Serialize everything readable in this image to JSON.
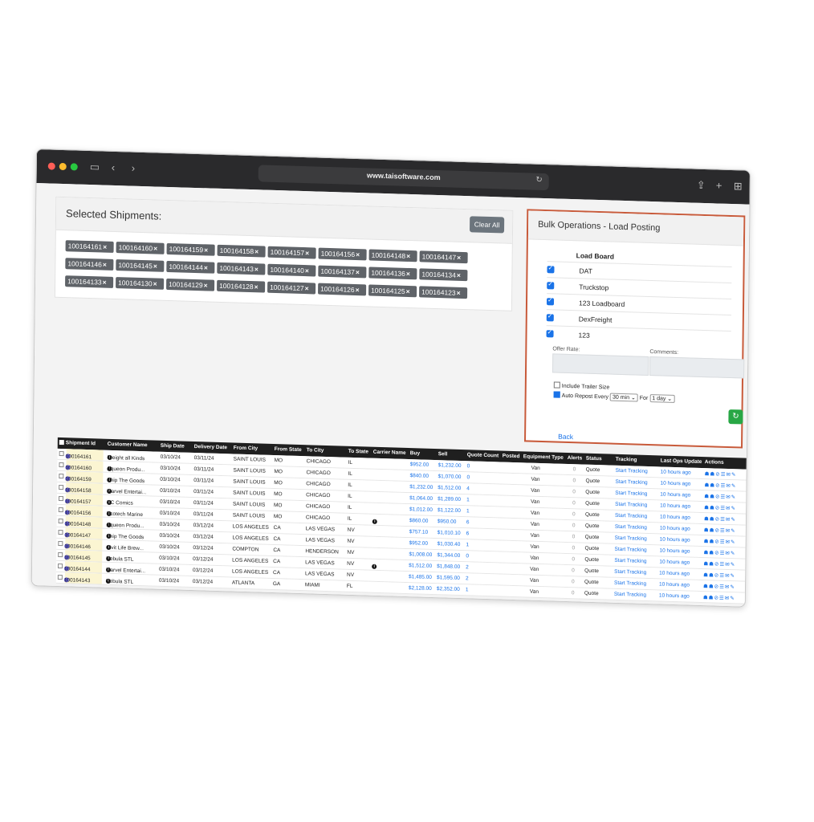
{
  "browser": {
    "url": "www.taisoftware.com"
  },
  "selected": {
    "title": "Selected Shipments:",
    "clear_label": "Clear All",
    "chips": [
      "100164161",
      "100164160",
      "100164159",
      "100164158",
      "100164157",
      "100164156",
      "100164148",
      "100164147",
      "100164146",
      "100164145",
      "100164144",
      "100164143",
      "100164140",
      "100164137",
      "100164136",
      "100164134",
      "100164133",
      "100164130",
      "100164129",
      "100164128",
      "100164127",
      "100164126",
      "100164125",
      "100164123"
    ]
  },
  "bulk": {
    "title": "Bulk Operations - Load Posting",
    "load_board_header": "Load Board",
    "boards": [
      "DAT",
      "Truckstop",
      "123 Loadboard",
      "DexFreight",
      "123"
    ],
    "offer_rate_label": "Offer Rate:",
    "comments_label": "Comments:",
    "include_trailer_label": "Include Trailer Size",
    "auto_repost_label": "Auto Repost Every",
    "repost_interval": "30 min",
    "for_label": "For",
    "repost_duration": "1 day",
    "back_label": "Back"
  },
  "table": {
    "headers": [
      "Shipment Id",
      "Customer Name",
      "Ship Date",
      "Delivery Date",
      "From City",
      "From State",
      "To City",
      "To State",
      "Carrier Name",
      "Buy",
      "Sell",
      "Quote Count",
      "Posted",
      "Equipment Type",
      "Alerts",
      "Status",
      "Tracking",
      "Last Ops Update",
      "Actions"
    ],
    "rows": [
      {
        "id": "100164161",
        "customer": "Freight all Kinds",
        "ship": "03/10/24",
        "deliv": "03/11/24",
        "fcity": "SAINT LOUIS",
        "fstate": "MO",
        "tcity": "CHICAGO",
        "tstate": "IL",
        "carrier": "",
        "buy": "$952.00",
        "sell": "$1,232.00",
        "qc": "0",
        "equip": "Van",
        "status": "Quote",
        "tracking": "Start Tracking",
        "ops": "10 hours ago"
      },
      {
        "id": "100164160",
        "customer": "Aqueon Produ...",
        "ship": "03/10/24",
        "deliv": "03/11/24",
        "fcity": "SAINT LOUIS",
        "fstate": "MO",
        "tcity": "CHICAGO",
        "tstate": "IL",
        "carrier": "",
        "buy": "$840.00",
        "sell": "$1,070.00",
        "qc": "0",
        "equip": "Van",
        "status": "Quote",
        "tracking": "Start Tracking",
        "ops": "10 hours ago"
      },
      {
        "id": "100164159",
        "customer": "Ship The Goods",
        "ship": "03/10/24",
        "deliv": "03/11/24",
        "fcity": "SAINT LOUIS",
        "fstate": "MO",
        "tcity": "CHICAGO",
        "tstate": "IL",
        "carrier": "",
        "buy": "$1,232.00",
        "sell": "$1,512.00",
        "qc": "4",
        "equip": "Van",
        "status": "Quote",
        "tracking": "Start Tracking",
        "ops": "10 hours ago"
      },
      {
        "id": "100164158",
        "customer": "Marvel Entertai...",
        "ship": "03/10/24",
        "deliv": "03/11/24",
        "fcity": "SAINT LOUIS",
        "fstate": "MO",
        "tcity": "CHICAGO",
        "tstate": "IL",
        "carrier": "",
        "buy": "$1,064.00",
        "sell": "$1,289.00",
        "qc": "1",
        "equip": "Van",
        "status": "Quote",
        "tracking": "Start Tracking",
        "ops": "10 hours ago"
      },
      {
        "id": "100164157",
        "customer": "DC Comics",
        "ship": "03/10/24",
        "deliv": "03/11/24",
        "fcity": "SAINT LOUIS",
        "fstate": "MO",
        "tcity": "CHICAGO",
        "tstate": "IL",
        "carrier": "",
        "buy": "$1,012.00",
        "sell": "$1,122.00",
        "qc": "1",
        "equip": "Van",
        "status": "Quote",
        "tracking": "Start Tracking",
        "ops": "10 hours ago"
      },
      {
        "id": "100164156",
        "customer": "Ecotech Marine",
        "ship": "03/10/24",
        "deliv": "03/11/24",
        "fcity": "SAINT LOUIS",
        "fstate": "MO",
        "tcity": "CHICAGO",
        "tstate": "IL",
        "carrier": "i",
        "buy": "$860.00",
        "sell": "$950.00",
        "qc": "6",
        "equip": "Van",
        "status": "Quote",
        "tracking": "Start Tracking",
        "ops": "10 hours ago"
      },
      {
        "id": "100164148",
        "customer": "Aqueon Produ...",
        "ship": "03/10/24",
        "deliv": "03/12/24",
        "fcity": "LOS ANGELES",
        "fstate": "CA",
        "tcity": "LAS VEGAS",
        "tstate": "NV",
        "carrier": "",
        "buy": "$757.10",
        "sell": "$1,010.10",
        "qc": "6",
        "equip": "Van",
        "status": "Quote",
        "tracking": "Start Tracking",
        "ops": "10 hours ago"
      },
      {
        "id": "100164147",
        "customer": "Ship The Goods",
        "ship": "03/10/24",
        "deliv": "03/12/24",
        "fcity": "LOS ANGELES",
        "fstate": "CA",
        "tcity": "LAS VEGAS",
        "tstate": "NV",
        "carrier": "",
        "buy": "$952.00",
        "sell": "$1,030.40",
        "qc": "1",
        "equip": "Van",
        "status": "Quote",
        "tracking": "Start Tracking",
        "ops": "10 hours ago"
      },
      {
        "id": "100164146",
        "customer": "Civit Life Brew...",
        "ship": "03/10/24",
        "deliv": "03/12/24",
        "fcity": "COMPTON",
        "fstate": "CA",
        "tcity": "HENDERSON",
        "tstate": "NV",
        "carrier": "",
        "buy": "$1,008.00",
        "sell": "$1,344.00",
        "qc": "0",
        "equip": "Van",
        "status": "Quote",
        "tracking": "Start Tracking",
        "ops": "10 hours ago"
      },
      {
        "id": "100164145",
        "customer": "Nebula STL",
        "ship": "03/10/24",
        "deliv": "03/12/24",
        "fcity": "LOS ANGELES",
        "fstate": "CA",
        "tcity": "LAS VEGAS",
        "tstate": "NV",
        "carrier": "i",
        "buy": "$1,512.00",
        "sell": "$1,848.00",
        "qc": "2",
        "equip": "Van",
        "status": "Quote",
        "tracking": "Start Tracking",
        "ops": "10 hours ago"
      },
      {
        "id": "100164144",
        "customer": "Marvel Entertai...",
        "ship": "03/10/24",
        "deliv": "03/12/24",
        "fcity": "LOS ANGELES",
        "fstate": "CA",
        "tcity": "LAS VEGAS",
        "tstate": "NV",
        "carrier": "",
        "buy": "$1,485.00",
        "sell": "$1,595.00",
        "qc": "2",
        "equip": "Van",
        "status": "Quote",
        "tracking": "Start Tracking",
        "ops": "10 hours ago"
      },
      {
        "id": "100164143",
        "customer": "Nebula STL",
        "ship": "03/10/24",
        "deliv": "03/12/24",
        "fcity": "ATLANTA",
        "fstate": "GA",
        "tcity": "MIAMI",
        "tstate": "FL",
        "carrier": "",
        "buy": "$2,128.00",
        "sell": "$2,352.00",
        "qc": "1",
        "equip": "Van",
        "status": "Quote",
        "tracking": "Start Tracking",
        "ops": "10 hours ago"
      }
    ],
    "alerts_placeholder": "0",
    "actions_icons": "☗☗⊘☰✉✎"
  }
}
